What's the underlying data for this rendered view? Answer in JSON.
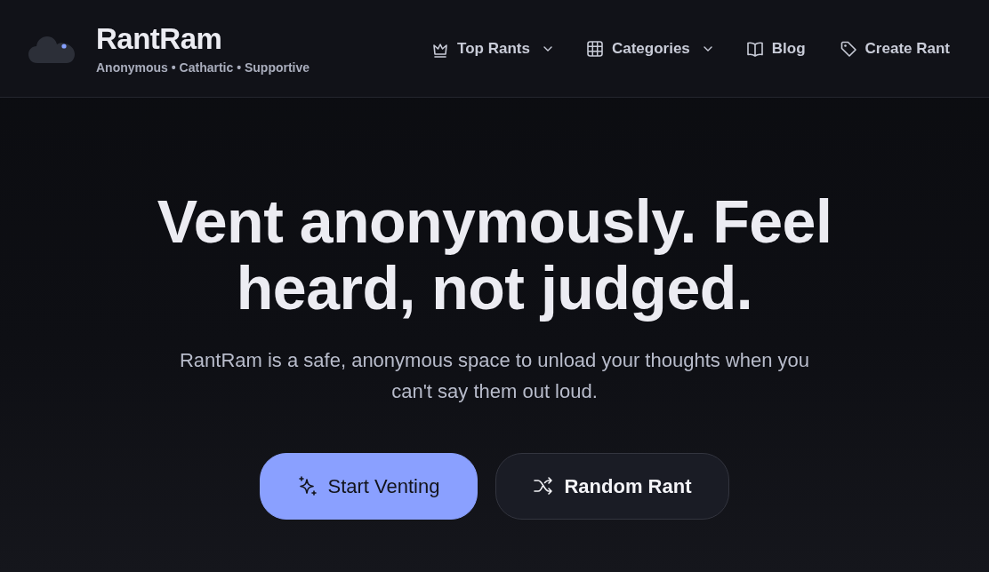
{
  "brand": {
    "name": "RantRam",
    "tagline": "Anonymous • Cathartic • Supportive"
  },
  "nav": [
    {
      "label": "Top Rants",
      "dropdown": true
    },
    {
      "label": "Categories",
      "dropdown": true
    },
    {
      "label": "Blog",
      "dropdown": false
    },
    {
      "label": "Create Rant",
      "dropdown": false
    }
  ],
  "hero": {
    "heading": "Vent anonymously. Feel heard, not judged.",
    "text": "RantRam is a safe, anonymous space to unload your thoughts when you can't say them out loud.",
    "buttons": [
      {
        "label": "Start Venting",
        "kind": "primary"
      },
      {
        "label": "Random Rant",
        "kind": "secondary"
      }
    ]
  }
}
